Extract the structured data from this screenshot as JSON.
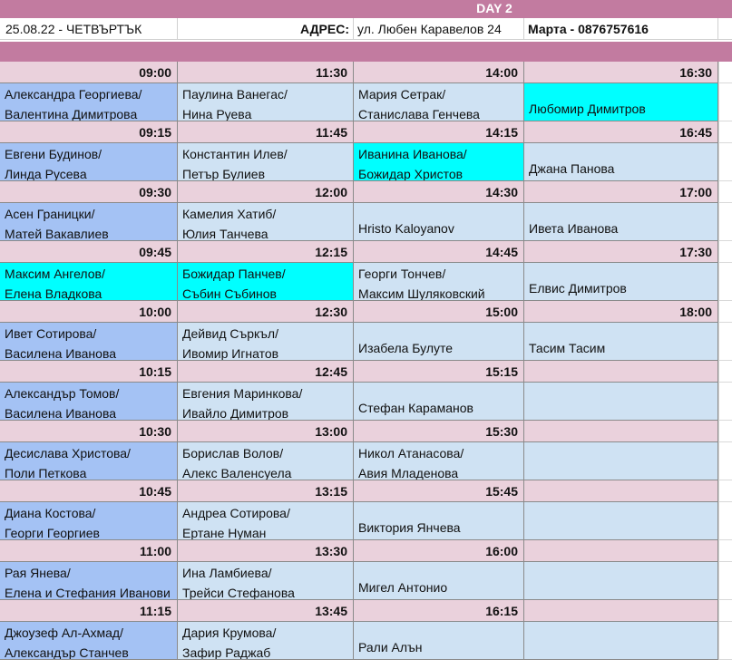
{
  "banner": {
    "title": "DAY 2"
  },
  "info": {
    "date": "25.08.22 - ЧЕТВЪРТЪК",
    "address_label": "АДРЕС:",
    "address": "ул. Любен Каравелов 24",
    "contact": "Марта - 0876757616"
  },
  "colors": {
    "banner": "#c27ba0",
    "time_row": "#ead1dc",
    "first_column": "#a4c2f4",
    "other_columns": "#cfe2f3",
    "highlight": "#00ffff"
  },
  "rows": [
    {
      "times": [
        "09:00",
        "11:30",
        "14:00",
        "16:30"
      ],
      "cells": [
        {
          "lines": [
            "Александра Георгиева/",
            "Валентина Димитрова"
          ]
        },
        {
          "lines": [
            "Паулина Ванегас/",
            "Нина Руева"
          ]
        },
        {
          "lines": [
            "Мария Сетрак/",
            "Станислава Генчева"
          ]
        },
        {
          "lines": [
            "Любомир Димитров"
          ],
          "highlight": true
        }
      ]
    },
    {
      "times": [
        "09:15",
        "11:45",
        "14:15",
        "16:45"
      ],
      "cells": [
        {
          "lines": [
            "Евгени Будинов/",
            "Линда Русева"
          ]
        },
        {
          "lines": [
            "Константин Илев/",
            "Петър Булиев"
          ]
        },
        {
          "lines": [
            "Иванина Иванова/",
            "Божидар Христов"
          ],
          "highlight": true
        },
        {
          "lines": [
            "Джана Панова"
          ]
        }
      ]
    },
    {
      "times": [
        "09:30",
        "12:00",
        "14:30",
        "17:00"
      ],
      "cells": [
        {
          "lines": [
            "Асен Границки/",
            "Матей Вакавлиев"
          ]
        },
        {
          "lines": [
            "Камелия Хатиб/",
            "Юлия Танчева"
          ]
        },
        {
          "lines": [
            "Hristo Kaloyanov"
          ]
        },
        {
          "lines": [
            "Ивета Иванова"
          ]
        }
      ]
    },
    {
      "times": [
        "09:45",
        "12:15",
        "14:45",
        "17:30"
      ],
      "cells": [
        {
          "lines": [
            "Максим Ангелов/",
            "Елена Владкова"
          ],
          "highlight": true
        },
        {
          "lines": [
            "Божидар Панчев/",
            "Събин Събинов"
          ],
          "highlight": true
        },
        {
          "lines": [
            "Георги Тончев/",
            "Максим Шуляковский"
          ]
        },
        {
          "lines": [
            "Елвис Димитров"
          ]
        }
      ]
    },
    {
      "times": [
        "10:00",
        "12:30",
        "15:00",
        "18:00"
      ],
      "cells": [
        {
          "lines": [
            "Ивет Сотирова/",
            "Василена Иванова"
          ]
        },
        {
          "lines": [
            "Дейвид Съркъл/",
            "Ивомир Игнатов"
          ]
        },
        {
          "lines": [
            "Изабела Булуте"
          ]
        },
        {
          "lines": [
            "Тасим Тасим"
          ]
        }
      ]
    },
    {
      "times": [
        "10:15",
        "12:45",
        "15:15",
        ""
      ],
      "cells": [
        {
          "lines": [
            "Александър Томов/",
            "Василена Иванова"
          ]
        },
        {
          "lines": [
            "Евгения Маринкова/",
            "Ивайло Димитров"
          ]
        },
        {
          "lines": [
            "Стефан Караманов"
          ]
        },
        {
          "lines": []
        }
      ]
    },
    {
      "times": [
        "10:30",
        "13:00",
        "15:30",
        ""
      ],
      "cells": [
        {
          "lines": [
            "Десислава Христова/",
            "Поли Петкова"
          ]
        },
        {
          "lines": [
            "Борислав Волов/",
            "Алекс Валенсуела"
          ]
        },
        {
          "lines": [
            "Никол Атанасова/",
            "Авия Младенова"
          ]
        },
        {
          "lines": []
        }
      ]
    },
    {
      "times": [
        "10:45",
        "13:15",
        "15:45",
        ""
      ],
      "cells": [
        {
          "lines": [
            "Диана Костова/",
            "Георги Георгиев"
          ]
        },
        {
          "lines": [
            "Андреа Сотирова/",
            "Ертане Нуман"
          ]
        },
        {
          "lines": [
            "Виктория Янчева"
          ]
        },
        {
          "lines": []
        }
      ]
    },
    {
      "times": [
        "11:00",
        "13:30",
        "16:00",
        ""
      ],
      "cells": [
        {
          "lines": [
            "Рая Янева/",
            "Елена и Стефания Иванови"
          ]
        },
        {
          "lines": [
            "Ина Ламбиева/",
            "Трейси Стефанова"
          ]
        },
        {
          "lines": [
            "Мигел Антонио"
          ]
        },
        {
          "lines": []
        }
      ]
    },
    {
      "times": [
        "11:15",
        "13:45",
        "16:15",
        ""
      ],
      "cells": [
        {
          "lines": [
            "Джоузеф Ал-Ахмад/",
            "Александър Станчев"
          ]
        },
        {
          "lines": [
            "Дария Крумова/",
            "Зафир Раджаб"
          ]
        },
        {
          "lines": [
            "Рали Алън"
          ]
        },
        {
          "lines": []
        }
      ]
    }
  ]
}
